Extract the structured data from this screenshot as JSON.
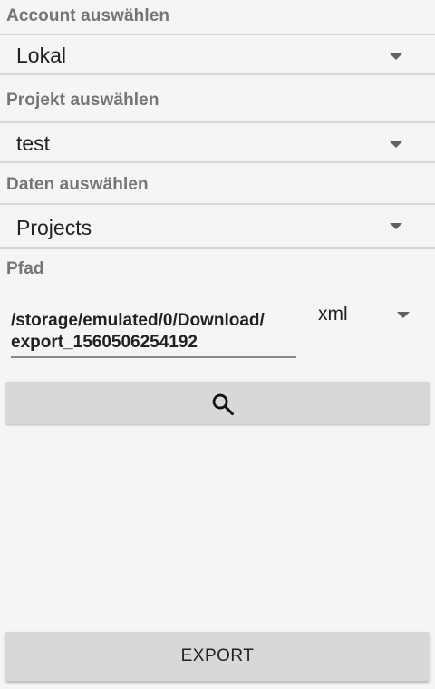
{
  "account": {
    "label": "Account auswählen",
    "selected": "Lokal"
  },
  "project": {
    "label": "Projekt auswählen",
    "selected": "test"
  },
  "data": {
    "label": "Daten auswählen",
    "selected": "Projects"
  },
  "path": {
    "label": "Pfad",
    "value_line1": "/storage/emulated/0/Download/",
    "value_line2": "export_1560506254192"
  },
  "format": {
    "selected": "xml"
  },
  "search_button": {
    "icon": "search-icon"
  },
  "export_button": {
    "label": "EXPORT"
  },
  "colors": {
    "background": "#f5f5f5",
    "label": "#757575",
    "divider": "#d6d6d6",
    "button": "#d8d8d8"
  }
}
